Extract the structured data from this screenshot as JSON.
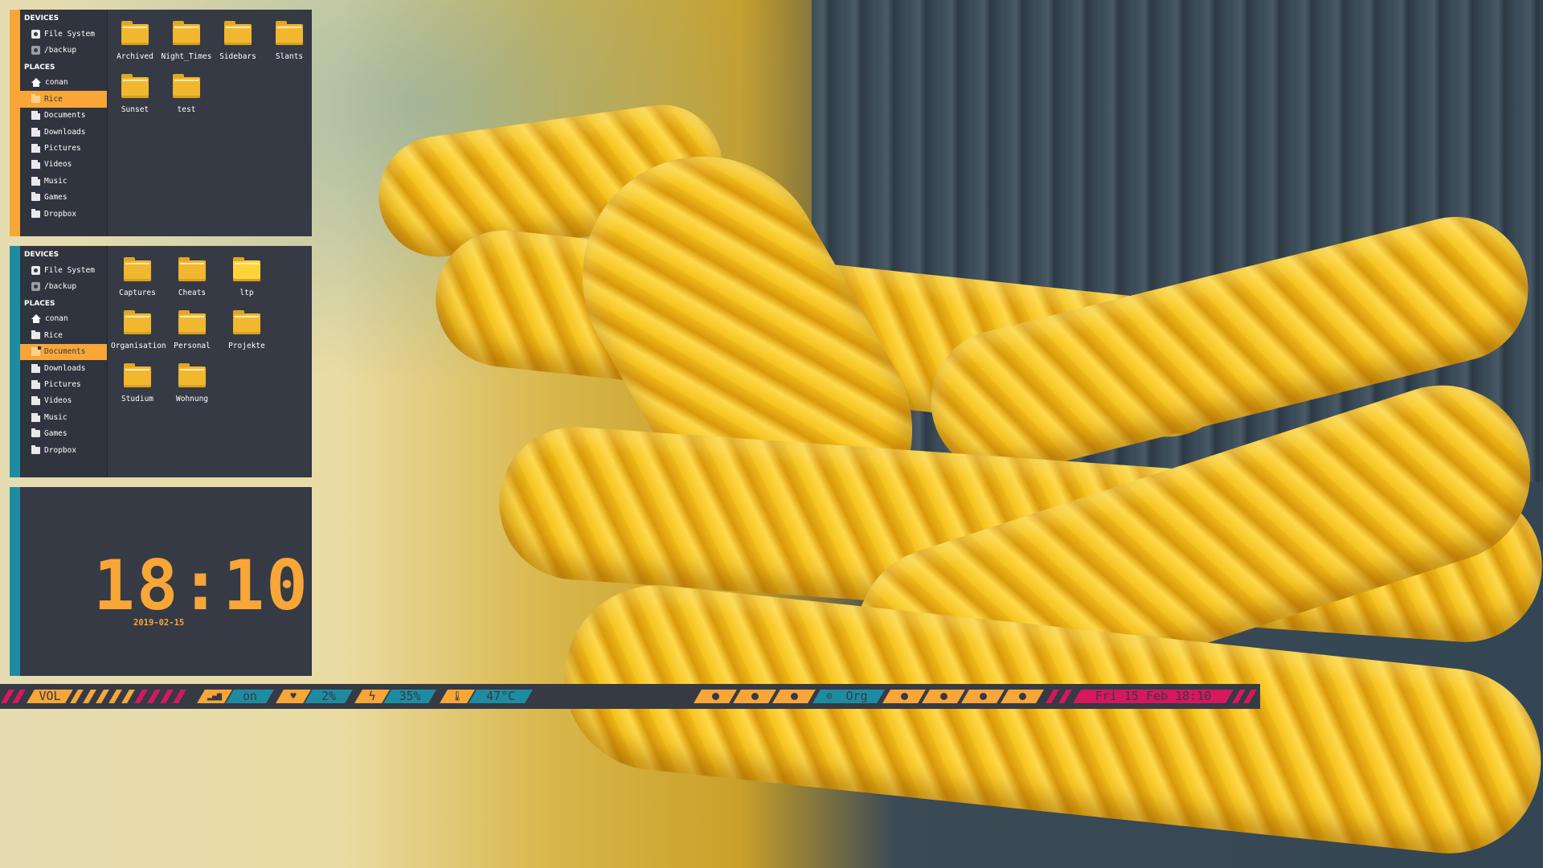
{
  "colors": {
    "accent_orange": "#f7a637",
    "accent_teal": "#1e8ca0",
    "accent_pink": "#d6185c",
    "panel_bg": "#363a45"
  },
  "file_manager_1": {
    "sidebar": {
      "devices_header": "DEVICES",
      "devices": [
        {
          "label": "File System",
          "icon": "drive-icon"
        },
        {
          "label": "/backup",
          "icon": "drive-icon"
        }
      ],
      "places_header": "PLACES",
      "places": [
        {
          "label": "conan",
          "icon": "home-icon"
        },
        {
          "label": "Rice",
          "icon": "folder-icon",
          "selected": true
        },
        {
          "label": "Documents",
          "icon": "documents-icon"
        },
        {
          "label": "Downloads",
          "icon": "downloads-icon"
        },
        {
          "label": "Pictures",
          "icon": "pictures-icon"
        },
        {
          "label": "Videos",
          "icon": "videos-icon"
        },
        {
          "label": "Music",
          "icon": "music-icon"
        },
        {
          "label": "Games",
          "icon": "folder-icon"
        },
        {
          "label": "Dropbox",
          "icon": "folder-icon"
        }
      ]
    },
    "items": [
      "Archived",
      "Night_Times",
      "Sidebars",
      "Slants",
      "Sunset",
      "test"
    ]
  },
  "file_manager_2": {
    "sidebar": {
      "devices_header": "DEVICES",
      "devices": [
        {
          "label": "File System",
          "icon": "drive-icon"
        },
        {
          "label": "/backup",
          "icon": "drive-icon"
        }
      ],
      "places_header": "PLACES",
      "places": [
        {
          "label": "conan",
          "icon": "home-icon"
        },
        {
          "label": "Rice",
          "icon": "folder-icon"
        },
        {
          "label": "Documents",
          "icon": "documents-icon",
          "selected": true
        },
        {
          "label": "Downloads",
          "icon": "downloads-icon"
        },
        {
          "label": "Pictures",
          "icon": "pictures-icon"
        },
        {
          "label": "Videos",
          "icon": "videos-icon"
        },
        {
          "label": "Music",
          "icon": "music-icon"
        },
        {
          "label": "Games",
          "icon": "folder-icon"
        },
        {
          "label": "Dropbox",
          "icon": "folder-icon"
        }
      ]
    },
    "items": [
      "Captures",
      "Cheats",
      "ltp",
      "Organisation",
      "Personal",
      "Projekte",
      "Studium",
      "Wohnung"
    ]
  },
  "clock": {
    "time": "18:10",
    "date": "2019-02-15"
  },
  "bar": {
    "vol_label": "VOL",
    "wifi_value": "on",
    "cpu_value": "2%",
    "battery_value": "35%",
    "temp_value": "47°C",
    "workspace_label": "Org",
    "datetime": "Fri 15 Feb 18:10"
  }
}
